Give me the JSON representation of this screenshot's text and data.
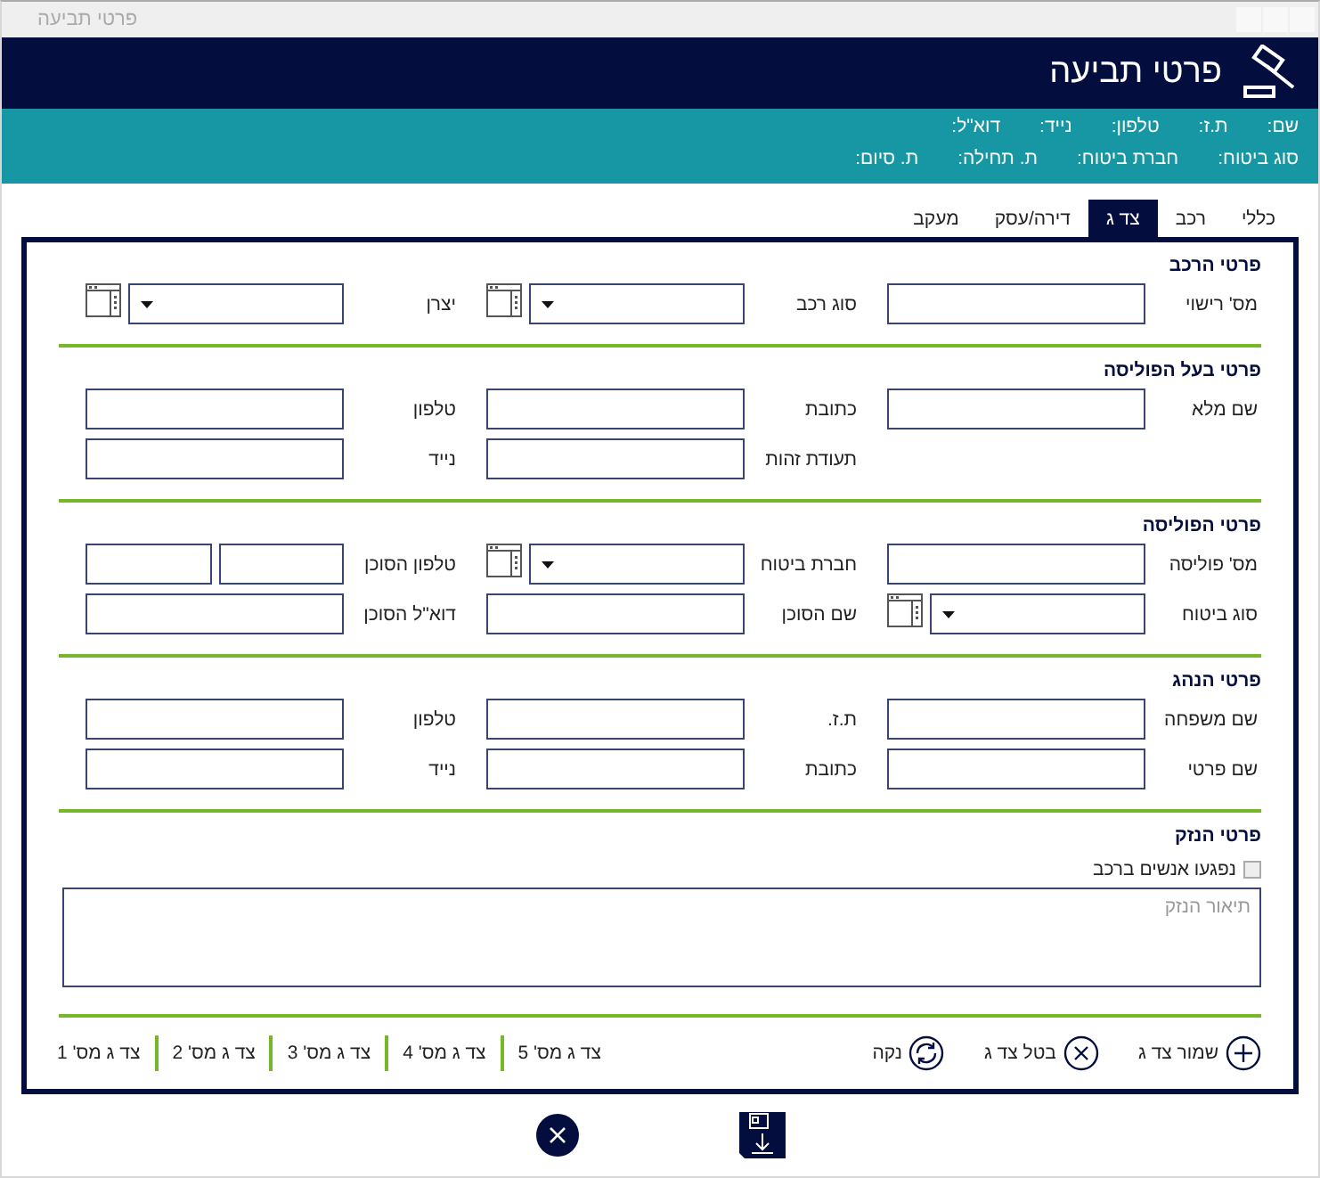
{
  "window": {
    "title": "פרטי תביעה"
  },
  "header": {
    "title": "פרטי תביעה"
  },
  "summary": {
    "contact_labels": [
      "שם:",
      "ת.ז:",
      "טלפון:",
      "נייד:",
      "דוא\"ל:"
    ],
    "policy_labels": [
      "סוג ביטוח:",
      "חברת ביטוח:",
      "ת. תחילה:",
      "ת. סיום:"
    ]
  },
  "tabs": [
    {
      "label": "כללי",
      "selected": false
    },
    {
      "label": "רכב",
      "selected": false
    },
    {
      "label": "צד ג",
      "selected": true
    },
    {
      "label": "דירה/עסק",
      "selected": false
    },
    {
      "label": "מעקב",
      "selected": false
    }
  ],
  "sections": [
    {
      "title": "פרטי הרכב",
      "rows": [
        [
          {
            "label": "מס' רישוי",
            "kind": "text"
          },
          {
            "label": "סוג רכב",
            "kind": "select"
          },
          {
            "label": "יצרן",
            "kind": "select"
          }
        ]
      ]
    },
    {
      "title": "פרטי בעל הפוליסה",
      "rows": [
        [
          {
            "label": "שם מלא",
            "kind": "text"
          },
          {
            "label": "כתובת",
            "kind": "text"
          },
          {
            "label": "טלפון",
            "kind": "text"
          }
        ],
        [
          null,
          {
            "label": "תעודת זהות",
            "kind": "text"
          },
          {
            "label": "נייד",
            "kind": "text"
          }
        ]
      ]
    },
    {
      "title": "פרטי הפוליסה",
      "rows": [
        [
          {
            "label": "מס' פוליסה",
            "kind": "text"
          },
          {
            "label": "חברת ביטוח",
            "kind": "select"
          },
          {
            "label": "טלפון הסוכן",
            "kind": "split"
          }
        ],
        [
          {
            "label": "סוג ביטוח",
            "kind": "select"
          },
          {
            "label": "שם הסוכן",
            "kind": "text"
          },
          {
            "label": "דוא\"ל הסוכן",
            "kind": "text"
          }
        ]
      ]
    },
    {
      "title": "פרטי הנהג",
      "rows": [
        [
          {
            "label": "שם משפחה",
            "kind": "text"
          },
          {
            "label": "ת.ז.",
            "kind": "text"
          },
          {
            "label": "טלפון",
            "kind": "text"
          }
        ],
        [
          {
            "label": "שם פרטי",
            "kind": "text"
          },
          {
            "label": "כתובת",
            "kind": "text"
          },
          {
            "label": "נייד",
            "kind": "text"
          }
        ]
      ]
    }
  ],
  "damage": {
    "title": "פרטי הנזק",
    "checkbox": {
      "label": "נפגעו אנשים ברכב",
      "checked": false
    },
    "description": {
      "placeholder": "תיאור הנזק"
    }
  },
  "actions": [
    {
      "label": "שמור צד ג",
      "kind": "add"
    },
    {
      "label": "בטל צד ג",
      "kind": "cancel"
    },
    {
      "label": "נקה",
      "kind": "reset"
    }
  ],
  "third_parties": [
    "צד ג מס' 5",
    "צד ג מס' 4",
    "צד ג מס' 3",
    "צד ג מס' 2",
    "צד ג מס' 1"
  ]
}
